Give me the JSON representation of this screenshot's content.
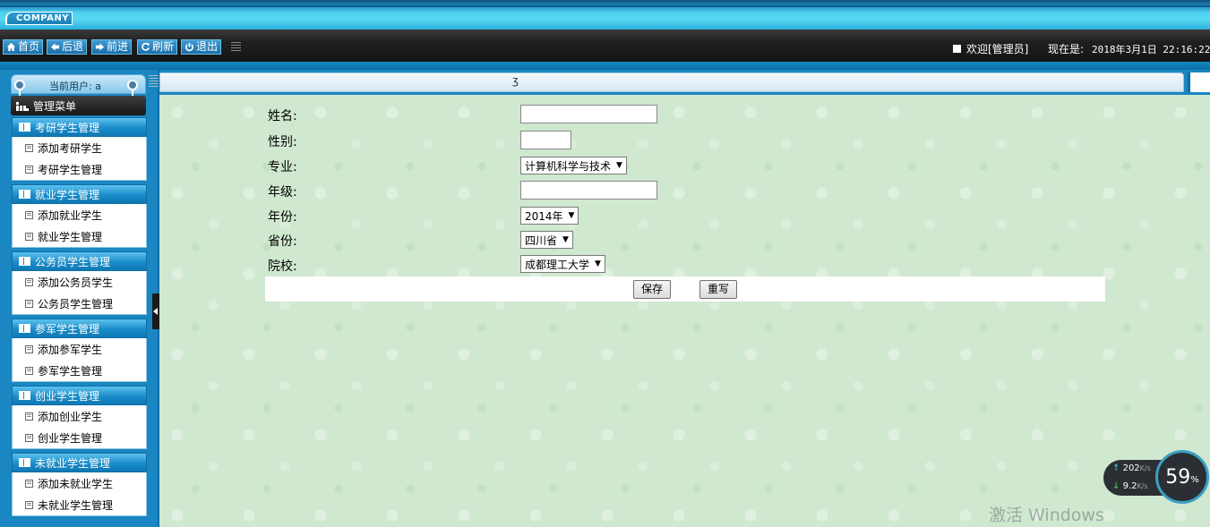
{
  "header": {
    "logo_text": "COMPANY"
  },
  "toolbar": {
    "home": "首页",
    "back": "后退",
    "forward": "前进",
    "refresh": "刷新",
    "logout": "退出",
    "welcome": "欢迎[管理员]",
    "now_label": "现在是:",
    "now_time": "2018年3月1日 22:16:22"
  },
  "sidebar": {
    "current_user": "当前用户: a",
    "menu_title": "管理菜单",
    "groups": [
      {
        "title": "考研学生管理",
        "items": [
          "添加考研学生",
          "考研学生管理"
        ]
      },
      {
        "title": "就业学生管理",
        "items": [
          "添加就业学生",
          "就业学生管理"
        ]
      },
      {
        "title": "公务员学生管理",
        "items": [
          "添加公务员学生",
          "公务员学生管理"
        ]
      },
      {
        "title": "参军学生管理",
        "items": [
          "添加参军学生",
          "参军学生管理"
        ]
      },
      {
        "title": "创业学生管理",
        "items": [
          "添加创业学生",
          "创业学生管理"
        ]
      },
      {
        "title": "未就业学生管理",
        "items": [
          "添加未就业学生",
          "未就业学生管理"
        ]
      }
    ]
  },
  "tab": {
    "glyph": "ӡ"
  },
  "form": {
    "name_label": "姓名:",
    "name_value": "",
    "gender_label": "性别:",
    "gender_value": "",
    "major_label": "专业:",
    "major_selected": "计算机科学与技术",
    "grade_label": "年级:",
    "grade_value": "",
    "year_label": "年份:",
    "year_selected": "2014年",
    "province_label": "省份:",
    "province_selected": "四川省",
    "school_label": "院校:",
    "school_selected": "成都理工大学",
    "save_label": "保存",
    "reset_label": "重写"
  },
  "net_widget": {
    "up_speed": "202",
    "down_speed": "9.2",
    "unit": "K/s",
    "percent": "59",
    "percent_sign": "%"
  },
  "watermark": "激活 Windows"
}
